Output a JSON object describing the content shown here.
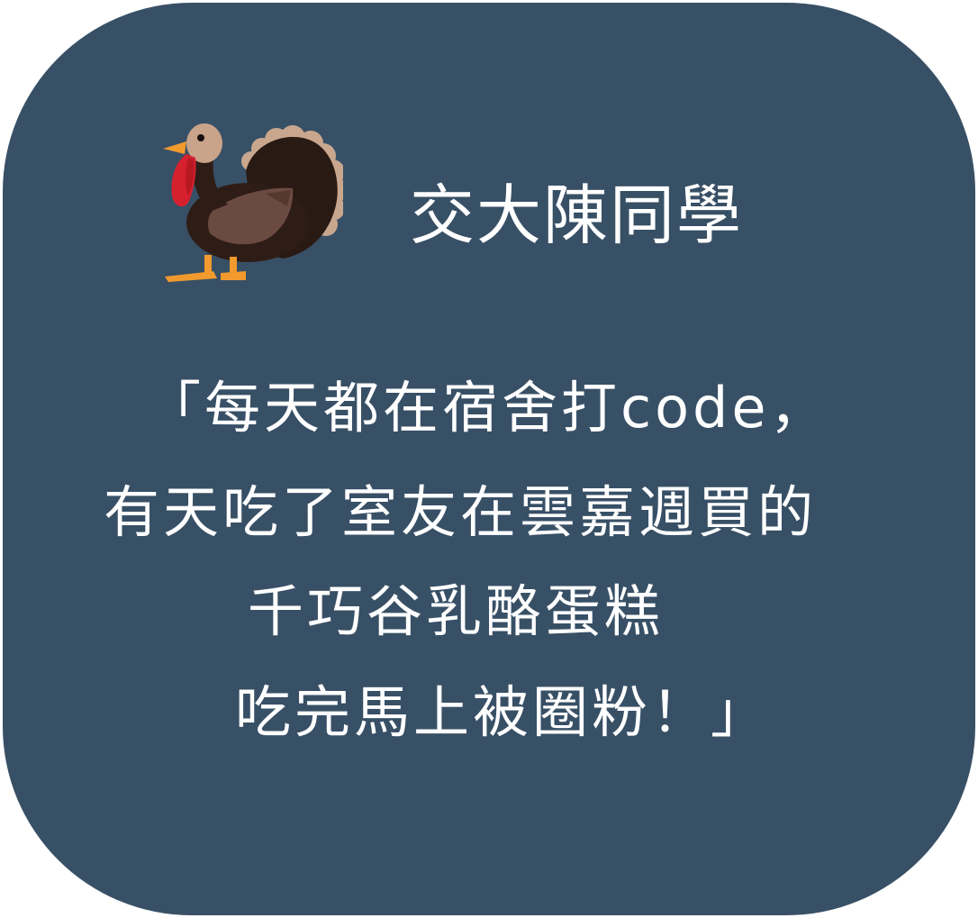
{
  "card": {
    "author": "交大陳同學",
    "quote_lines": [
      "「每天都在宿舍打code，",
      "有天吃了室友在雲嘉週買的",
      "千巧谷乳酪蛋糕",
      "吃完馬上被圈粉！」"
    ],
    "icon": "turkey-icon"
  },
  "colors": {
    "card_background": "#385066",
    "text": "#ffffff"
  }
}
